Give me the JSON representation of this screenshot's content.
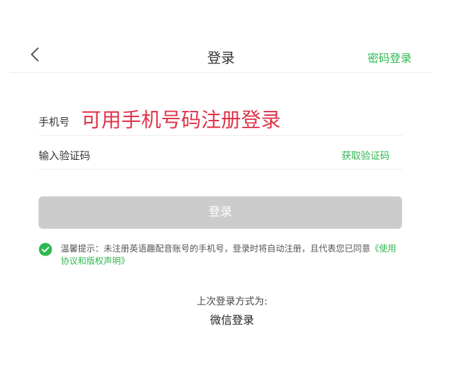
{
  "nav": {
    "title": "登录",
    "password_login": "密码登录"
  },
  "form": {
    "phone_label": "手机号",
    "phone_placeholder": "可用手机号码注册登录",
    "code_label": "输入验证码",
    "get_code": "获取验证码",
    "submit": "登录"
  },
  "agreement": {
    "checked": true,
    "text_part1": "温馨提示：未注册英语趣配音账号的手机号，登录时将自动注册，且代表您已同意",
    "link": "《使用协议和版权声明》"
  },
  "last_login": {
    "label": "上次登录方式为:",
    "method": "微信登录"
  },
  "colors": {
    "accent": "#2eb84f",
    "placeholder": "#e0344a",
    "button_disabled": "#cccccc"
  },
  "icons": {
    "back": "chevron-left-icon",
    "check": "check-circle-icon"
  }
}
